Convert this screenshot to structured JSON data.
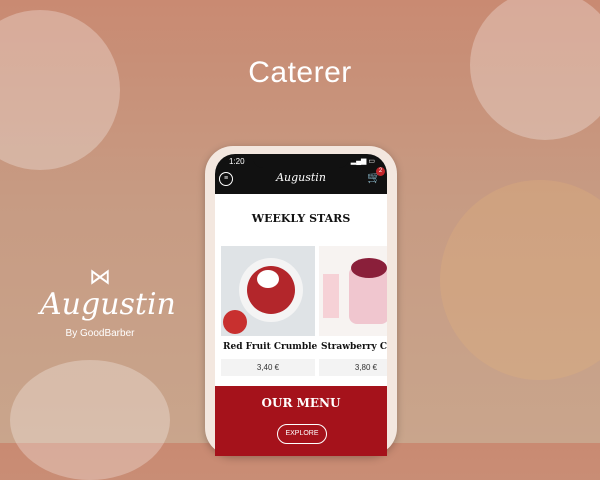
{
  "header": {
    "title": "Caterer"
  },
  "brand": {
    "name": "Augustin",
    "by": "By GoodBarber"
  },
  "phone": {
    "status_time": "1:20",
    "app_name": "Augustin",
    "cart_count": "2",
    "section_title": "WEEKLY STARS",
    "cards": [
      {
        "name": "Red Fruit Crumble",
        "price": "3,40 €"
      },
      {
        "name": "Strawberry Cr",
        "price": "3,80 €"
      }
    ],
    "menu": {
      "title": "OUR MENU",
      "button": "EXPLORE"
    }
  },
  "colors": {
    "accent": "#a5121b",
    "bg": "#c98a72"
  }
}
